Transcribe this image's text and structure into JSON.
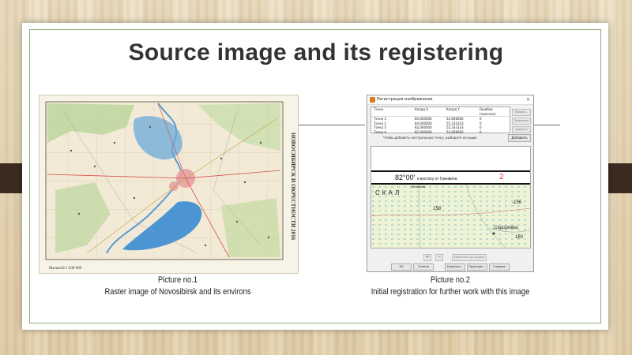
{
  "slide": {
    "title": "Source image and its registering"
  },
  "picture1": {
    "caption_line1": "Picture no.1",
    "caption_line2": "Raster image of Novosibirsk and its environs",
    "map_side_text": "НОВОСИБИРСК И ОКРЕСТНОСТИ 2016",
    "map_scale_text": "Масштаб 1:500 000"
  },
  "picture2": {
    "caption_line1": "Picture no.2",
    "caption_line2": "Initial registration for further work with this image"
  },
  "dialog": {
    "title": "Регистрация изображения",
    "table": {
      "headers": [
        "Точка",
        "Коорд X",
        "Коорд Y",
        "Ошибка (пиксели)"
      ],
      "rows": [
        [
          "Точка 1",
          "84,000000",
          "54,666666",
          "0"
        ],
        [
          "Точка 2",
          "84,000000",
          "55,333333",
          "0"
        ],
        [
          "Точка 3",
          "82,000000",
          "55,333333",
          "0"
        ],
        [
          "Точка 4",
          "82,000000",
          "54,666666",
          "0"
        ]
      ]
    },
    "side_buttons": [
      "Правка...",
      "Заменить",
      "Удалить"
    ],
    "hint": "Чтобы добавить контрольную точку, выберите ее выше",
    "add_button": "Добавить",
    "preview": {
      "coord": "82°00'",
      "coord_suffix": "к востоку от Гринвича",
      "point_number": "2",
      "map_labels": [
        "СКАЛ",
        "158",
        "-156",
        "Сидоровка",
        "160",
        "Лесобюдк"
      ]
    },
    "zoom_in": "+",
    "zoom_out": "−",
    "fit_button": "Увеличить до экрана",
    "bottom_buttons": [
      "OK",
      "Отмена",
      "Единицы...",
      "Проекция...",
      "Справка"
    ]
  },
  "colors": {
    "frame_green": "#8cae74",
    "tab_brown": "#3b2a20",
    "point_red": "#e03b2f",
    "app_icon": "#e07a1f"
  }
}
